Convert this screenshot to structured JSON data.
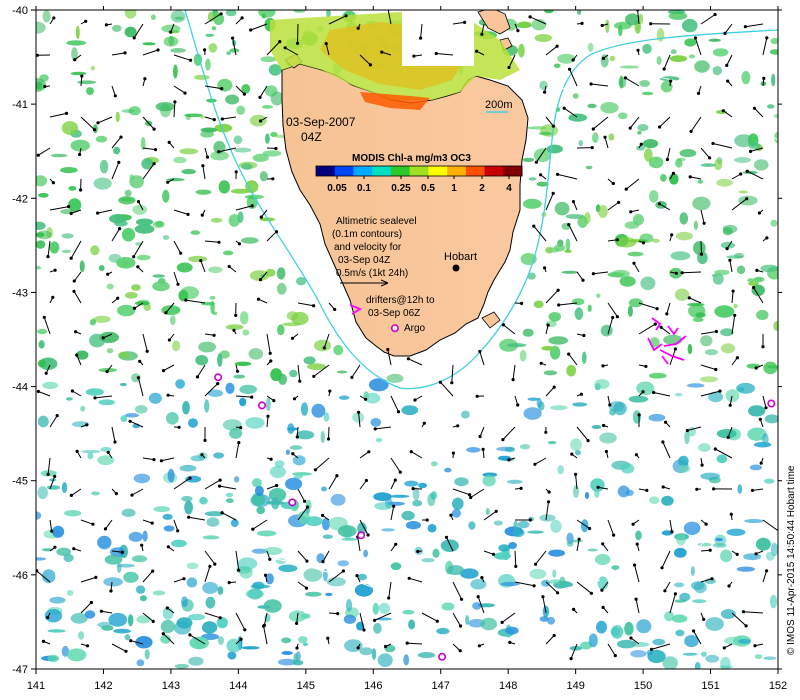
{
  "map": {
    "date_line1": "03-Sep-2007",
    "date_line2": "04Z",
    "colorbar": {
      "title": "MODIS Chl-a mg/m3 OC3",
      "ticks": [
        "0.05",
        "0.1",
        "0.25",
        "0.5",
        "1",
        "2",
        "4"
      ],
      "colors": [
        "#00007f",
        "#0044ff",
        "#00aaff",
        "#00e0c0",
        "#2ec82e",
        "#a0e020",
        "#ffff00",
        "#ffb000",
        "#ff5000",
        "#c80000",
        "#800000"
      ]
    },
    "altimetry_note": [
      "Altimetric sealevel",
      "(0.1m contours)",
      "and velocity for",
      "03-Sep 04Z",
      "0.5m/s (1kt 24h)"
    ],
    "drifter_note": [
      "drifters@12h to",
      "03-Sep 06Z"
    ],
    "argo_label": "Argo",
    "city_label": "Hobart",
    "depth_contour_label": "200m",
    "credit": "© IMOS 11-Apr-2015 14:50:44 Hobart time",
    "x_axis_ticks": [
      "141",
      "142",
      "143",
      "144",
      "145",
      "146",
      "147",
      "148",
      "149",
      "150",
      "151",
      "152"
    ],
    "y_axis_ticks": [
      "-40",
      "-41",
      "-42",
      "-43",
      "-44",
      "-45",
      "-46",
      "-47"
    ],
    "colors": {
      "land": "#fac59a",
      "contour_200m": "#40d0e0",
      "drifter": "#ff00ff",
      "argo": "#cc00cc",
      "vector": "#000000"
    },
    "argo_floats": [
      {
        "lon": 143.7,
        "lat": -43.9
      },
      {
        "lon": 144.35,
        "lat": -44.2
      },
      {
        "lon": 144.8,
        "lat": -45.23
      },
      {
        "lon": 145.82,
        "lat": -45.58
      },
      {
        "lon": 147.02,
        "lat": -46.87
      },
      {
        "lon": 151.9,
        "lat": -44.18
      },
      {
        "lon": 146.32,
        "lat": -43.38
      }
    ]
  }
}
